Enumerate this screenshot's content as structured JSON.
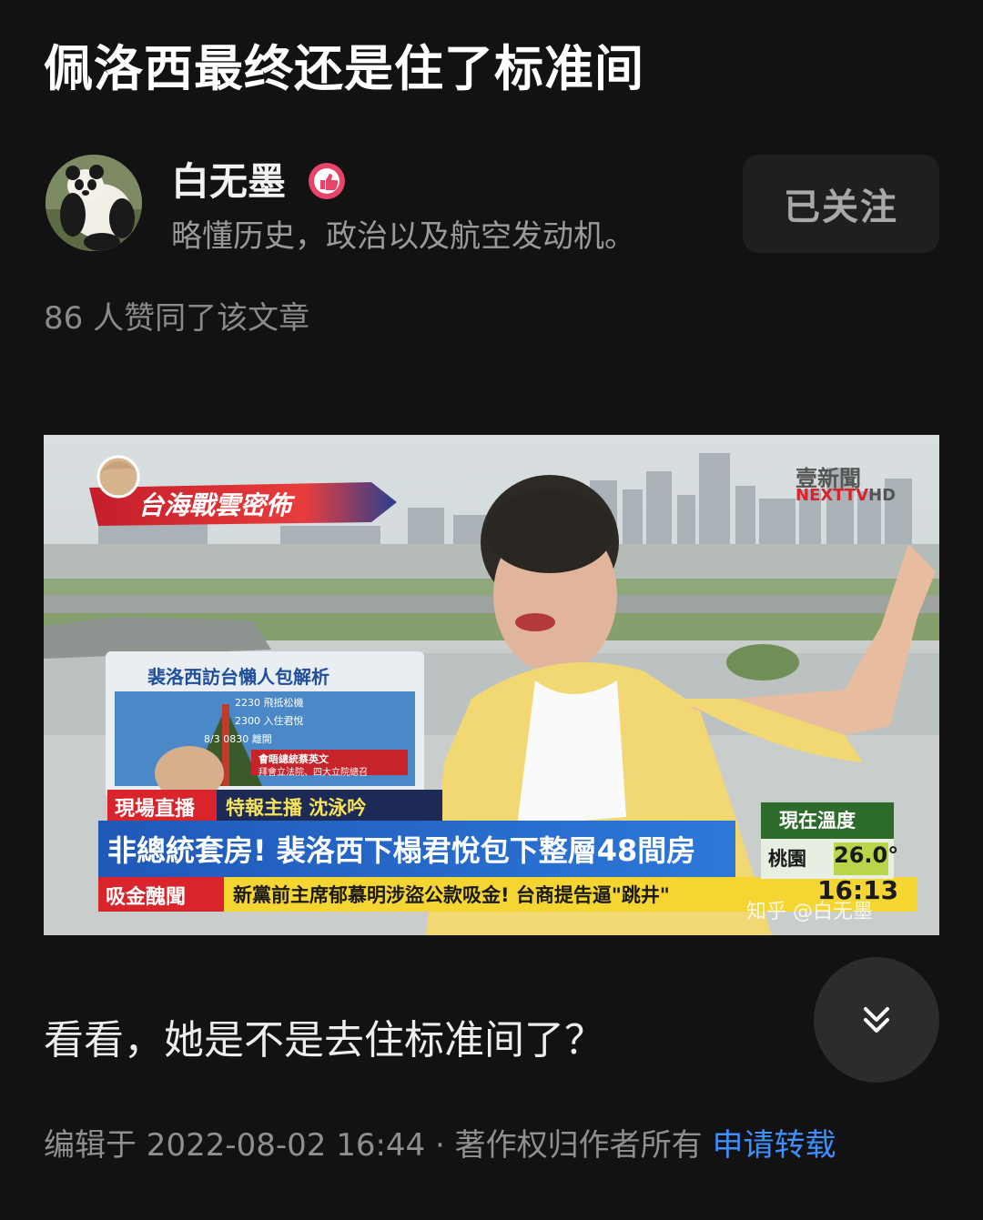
{
  "article": {
    "title": "佩洛西最终还是住了标准间"
  },
  "author": {
    "name": "白无墨",
    "bio": "略懂历史，政治以及航空发动机。",
    "follow_label": "已关注",
    "avatar_icon": "panda-avatar",
    "badge_icon": "thumbs-up-badge-icon"
  },
  "likes_text": "86 人赞同了该文章",
  "media": {
    "logo_cn": "壹新聞",
    "logo_en": "NEXTTV",
    "logo_hd": "HD",
    "segment_banner": "台海戰雲密佈",
    "board_title": "裴洛西訪台懶人包解析",
    "board_rows": [
      {
        "time": "2230",
        "event": "飛抵松機"
      },
      {
        "time": "2300",
        "event": "入住君悅"
      },
      {
        "time": "0830",
        "event": "離開",
        "date": "8/3"
      }
    ],
    "board_note_1": "會晤總統蔡英文",
    "board_note_2": "拜會立法院、四大立院總召",
    "live_tag": "現場直播",
    "reporter_tag": "特報主播 沈泳吟",
    "headline": "非總統套房! 裴洛西下榻君悅包下整層48間房",
    "news_tag": "吸金醜聞",
    "ticker": "新黨前主席郁慕明涉盜公款吸金! 台商提告逼\"跳井\"",
    "temp_title": "現在溫度",
    "temp_city": "桃園",
    "temp_value": "26.0°",
    "clock": "16:13",
    "watermark": "知乎 @白无墨"
  },
  "body_text": "看看，她是不是去住标准间了？",
  "footer": {
    "edited": "编辑于 2022-08-02 16:44",
    "separator": "·",
    "copyright": "著作权归作者所有",
    "repost_link": "申请转载"
  },
  "colors": {
    "background": "#121212",
    "link": "#3f8fff",
    "button_bg": "#1f1f1f"
  }
}
